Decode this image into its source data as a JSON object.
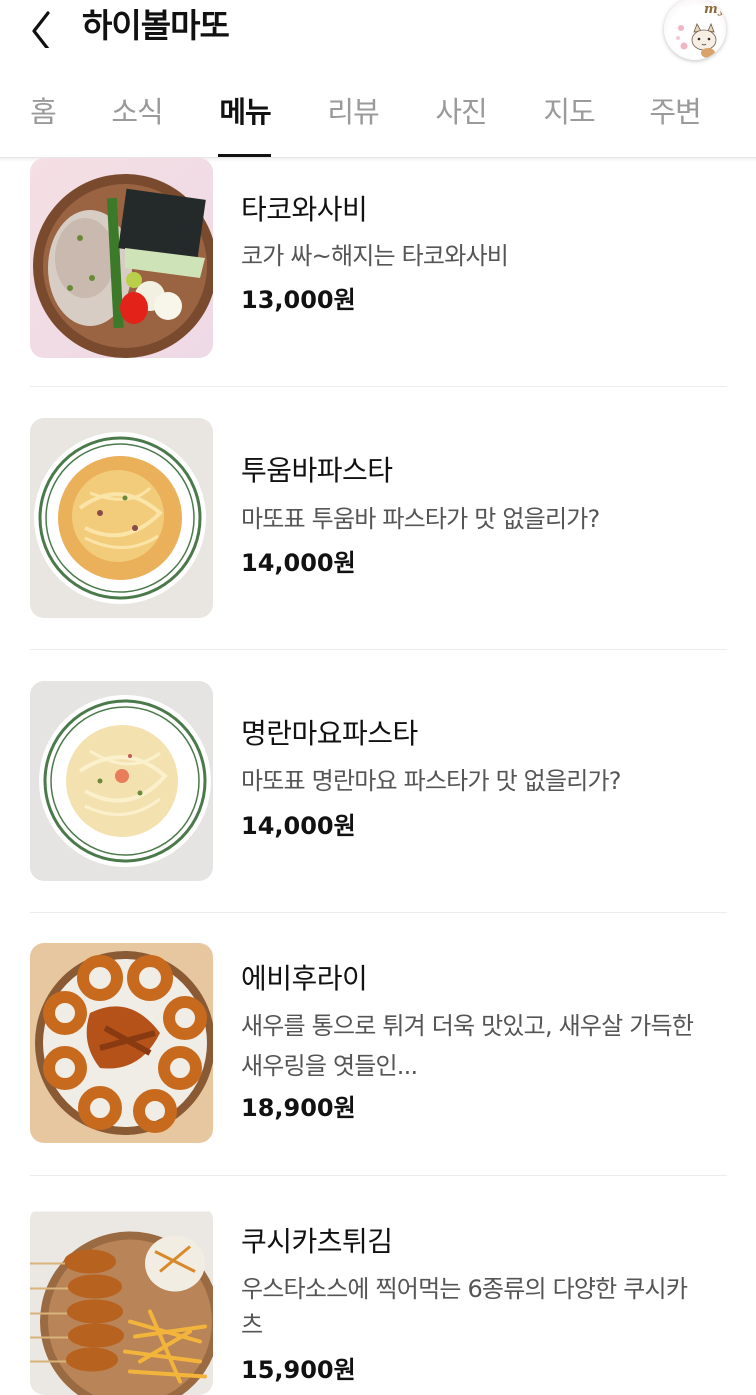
{
  "header": {
    "title": "하이볼마또",
    "avatar_text": "my"
  },
  "tabs": [
    {
      "label": "홈",
      "active": false
    },
    {
      "label": "소식",
      "active": false
    },
    {
      "label": "메뉴",
      "active": true
    },
    {
      "label": "리뷰",
      "active": false
    },
    {
      "label": "사진",
      "active": false
    },
    {
      "label": "지도",
      "active": false
    },
    {
      "label": "주변",
      "active": false
    }
  ],
  "menu": [
    {
      "name": "타코와사비",
      "desc_line1": "코가 싸~해지는 타코와사비",
      "desc_line2": "",
      "price": "13,000원"
    },
    {
      "name": "투움바파스타",
      "desc_line1": "마또표 투움바 파스타가 맛 없을리가?",
      "desc_line2": "",
      "price": "14,000원"
    },
    {
      "name": "명란마요파스타",
      "desc_line1": "마또표 명란마요 파스타가 맛 없을리가?",
      "desc_line2": "",
      "price": "14,000원"
    },
    {
      "name": "에비후라이",
      "desc_line1": "새우를 통으로 튀겨 더욱 맛있고, 새우살 가득한",
      "desc_line2": "새우링을 엿들인...",
      "price": "18,900원"
    },
    {
      "name": "쿠시카츠튀김",
      "desc_line1": "우스타소스에 찍어먹는 6종류의 다양한 쿠시카",
      "desc_line2": "츠",
      "price": "15,900원"
    }
  ],
  "colors": {
    "text_primary": "#111111",
    "text_secondary": "#555555",
    "tab_inactive": "#9a9a9a",
    "divider": "#ececec"
  },
  "icons": {
    "back": "chevron-left-icon"
  }
}
